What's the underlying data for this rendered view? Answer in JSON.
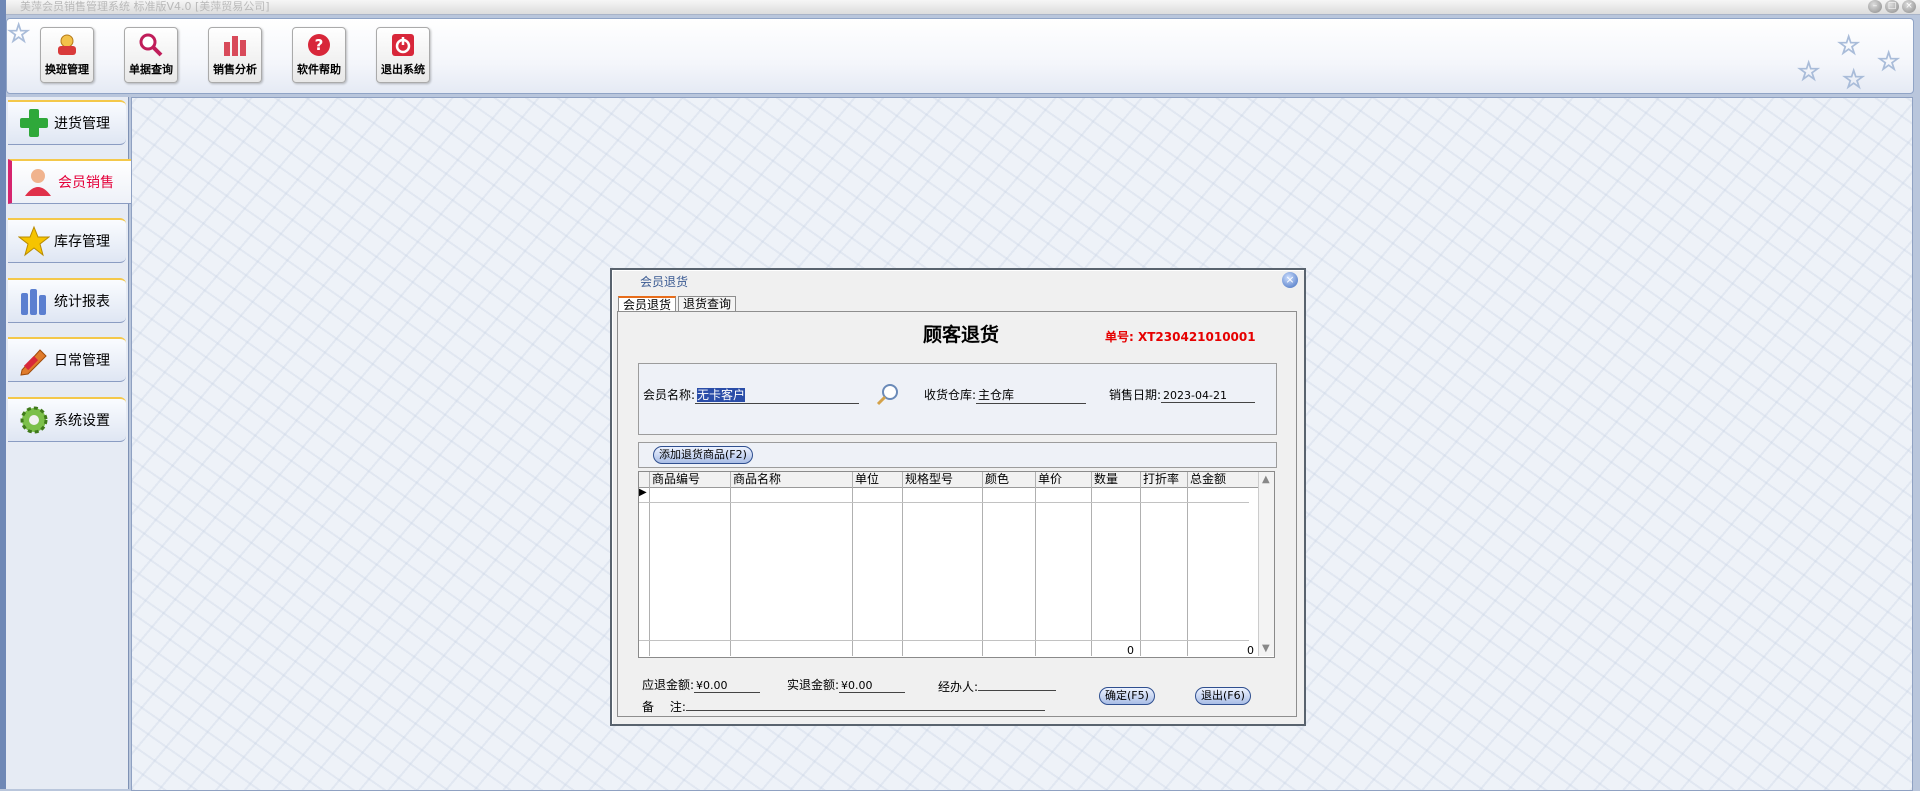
{
  "app": {
    "window_title": "美萍会员销售管理系统 标准版V4.0 [美萍贸易公司]"
  },
  "toolbar": {
    "items": [
      {
        "label": "换班管理",
        "icon": "shift-change-icon"
      },
      {
        "label": "单据查询",
        "icon": "magnifier-icon"
      },
      {
        "label": "销售分析",
        "icon": "bar-chart-icon"
      },
      {
        "label": "软件帮助",
        "icon": "help-icon"
      },
      {
        "label": "退出系统",
        "icon": "power-icon"
      }
    ]
  },
  "sidebar": {
    "items": [
      {
        "label": "进货管理",
        "icon": "plus-icon",
        "active": false
      },
      {
        "label": "会员销售",
        "icon": "member-icon",
        "active": true
      },
      {
        "label": "库存管理",
        "icon": "star-icon",
        "active": false
      },
      {
        "label": "统计报表",
        "icon": "report-icon",
        "active": false
      },
      {
        "label": "日常管理",
        "icon": "pencil-icon",
        "active": false
      },
      {
        "label": "系统设置",
        "icon": "gear-icon",
        "active": false
      }
    ]
  },
  "dialog": {
    "title": "会员退货",
    "tabs": [
      {
        "label": "会员退货",
        "active": true
      },
      {
        "label": "退货查询",
        "active": false
      }
    ],
    "heading": "顾客退货",
    "order_no": "单号: XT230421010001",
    "member_label": "会员名称:",
    "member_value": "无卡客户",
    "warehouse_label": "收货仓库:",
    "warehouse_value": "主仓库",
    "date_label": "销售日期:",
    "date_value": "2023-04-21",
    "add_button": "添加退货商品(F2)",
    "grid": {
      "columns": [
        "商品编号",
        "商品名称",
        "单位",
        "规格型号",
        "颜色",
        "单价",
        "数量",
        "打折率",
        "总金额"
      ],
      "totals": {
        "qty": "0",
        "amount": "0"
      }
    },
    "refund_due_label": "应退金额:",
    "refund_due_value": "¥0.00",
    "refund_actual_label": "实退金额:",
    "refund_actual_value": "¥0.00",
    "handler_label": "经办人:",
    "handler_value": "",
    "remark_label": "备　 注:",
    "remark_value": "",
    "confirm_button": "确定(F5)",
    "exit_button": "退出(F6)"
  },
  "colors": {
    "accent_blue": "#6f88b6",
    "active_red": "#e4003a",
    "order_red": "#e60000"
  }
}
